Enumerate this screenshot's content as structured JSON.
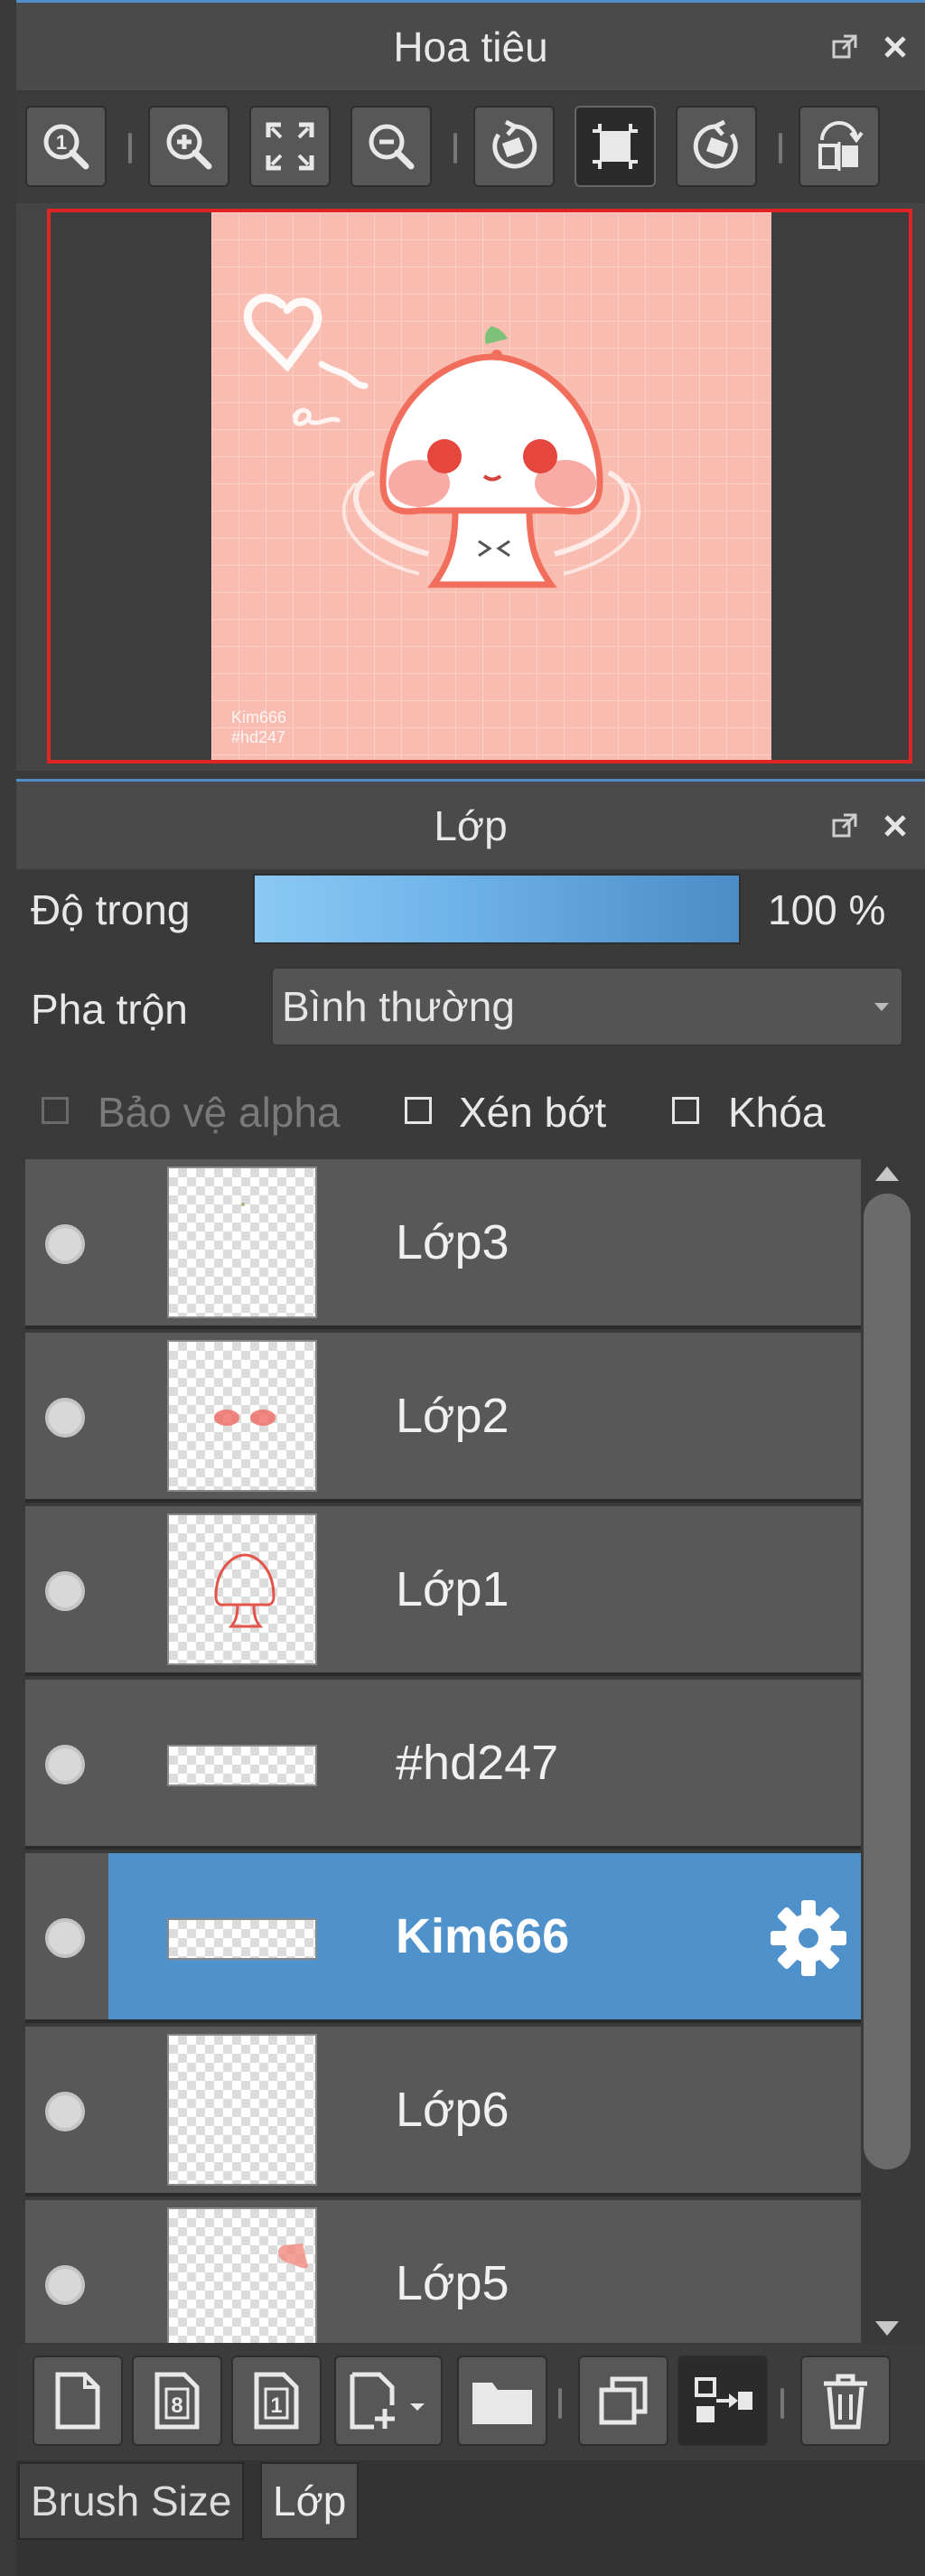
{
  "navigator": {
    "title": "Hoa tiêu",
    "toolbar": [
      {
        "icon": "zoom-actual-icon",
        "name": "zoom-100-button"
      },
      {
        "icon": "zoom-in-icon",
        "name": "zoom-in-button"
      },
      {
        "icon": "fit-window-icon",
        "name": "fit-window-button"
      },
      {
        "icon": "zoom-out-icon",
        "name": "zoom-out-button"
      },
      {
        "icon": "rotate-left-icon",
        "name": "rotate-left-button"
      },
      {
        "icon": "reset-rotation-icon",
        "name": "reset-view-button",
        "active": true
      },
      {
        "icon": "rotate-right-icon",
        "name": "rotate-right-button"
      },
      {
        "icon": "flip-horizontal-icon",
        "name": "flip-button"
      }
    ],
    "preview_text": [
      "Kim666",
      "#hd247"
    ]
  },
  "layer_panel": {
    "title": "Lớp",
    "opacity_label": "Độ trong",
    "opacity_value": "100 %",
    "opacity_fraction": 1.0,
    "blend_label": "Pha trộn",
    "blend_value": "Bình thường",
    "protect_alpha": {
      "label": "Bảo vệ alpha",
      "checked": false,
      "enabled": false
    },
    "clipping": {
      "label": "Xén bớt",
      "checked": false
    },
    "lock": {
      "label": "Khóa",
      "checked": false
    },
    "layers": [
      {
        "name": "Lớp3",
        "thumb": "square",
        "selected": false
      },
      {
        "name": "Lớp2",
        "thumb": "square",
        "selected": false
      },
      {
        "name": "Lớp1",
        "thumb": "square",
        "selected": false
      },
      {
        "name": "#hd247",
        "thumb": "wide",
        "selected": false
      },
      {
        "name": "Kim666",
        "thumb": "wide",
        "selected": true
      },
      {
        "name": "Lớp6",
        "thumb": "square",
        "selected": false
      },
      {
        "name": "Lớp5",
        "thumb": "square",
        "selected": false
      }
    ],
    "bottom_toolbar": [
      {
        "icon": "new-layer-icon",
        "name": "new-layer-button"
      },
      {
        "icon": "new-8bit-layer-icon",
        "name": "new-8bit-layer-button",
        "glyph": "8"
      },
      {
        "icon": "new-1bit-layer-icon",
        "name": "new-1bit-layer-button",
        "glyph": "1"
      },
      {
        "icon": "add-layer-menu-icon",
        "name": "add-layer-menu-button"
      },
      {
        "icon": "folder-icon",
        "name": "new-folder-button"
      },
      {
        "icon": "duplicate-layer-icon",
        "name": "duplicate-layer-button"
      },
      {
        "icon": "merge-down-icon",
        "name": "merge-down-button"
      },
      {
        "icon": "trash-icon",
        "name": "delete-layer-button"
      }
    ]
  },
  "tabs": [
    {
      "label": "Brush Size",
      "active": false
    },
    {
      "label": "Lớp",
      "active": true
    }
  ],
  "colors": {
    "accent": "#4f92cb",
    "preview_border": "#e02424",
    "canvas_bg": "#f8bcb1"
  }
}
